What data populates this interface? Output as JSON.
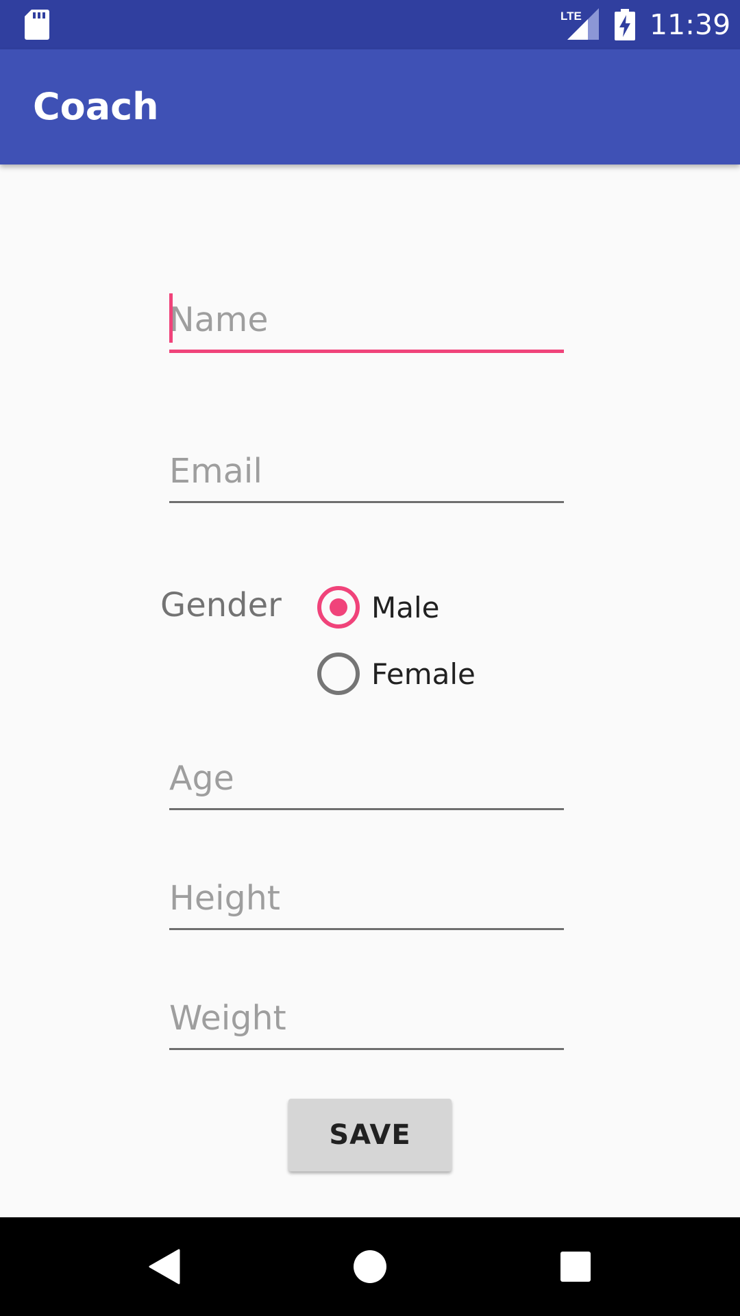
{
  "status_bar": {
    "time": "11:39",
    "network_label": "LTE",
    "icons": [
      "sd-card-icon",
      "lte-signal-icon",
      "battery-charging-icon"
    ]
  },
  "app_bar": {
    "title": "Coach"
  },
  "form": {
    "name": {
      "value": "",
      "placeholder": "Name"
    },
    "email": {
      "value": "",
      "placeholder": "Email"
    },
    "gender": {
      "label": "Gender",
      "options": [
        {
          "label": "Male",
          "checked": true
        },
        {
          "label": "Female",
          "checked": false
        }
      ]
    },
    "age": {
      "value": "",
      "placeholder": "Age"
    },
    "height": {
      "value": "",
      "placeholder": "Height"
    },
    "weight": {
      "value": "",
      "placeholder": "Weight"
    },
    "save_label": "SAVE"
  },
  "nav_bar": {
    "icons": [
      "back-icon",
      "home-icon",
      "recents-icon"
    ]
  },
  "colors": {
    "status_bar": "#303f9f",
    "app_bar": "#3f51b5",
    "accent": "#f0437a",
    "background": "#fafafa"
  }
}
